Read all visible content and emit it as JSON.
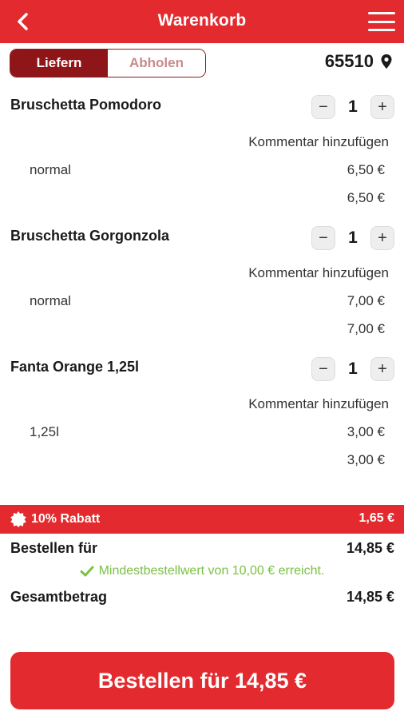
{
  "header": {
    "title": "Warenkorb",
    "accent": "#e32b2f",
    "back_icon": "chevron-left-icon",
    "menu_icon": "hamburger-menu-icon"
  },
  "delivery_toggle": {
    "options": [
      "Liefern",
      "Abholen"
    ],
    "selected": "Liefern"
  },
  "postcode": {
    "value": "65510",
    "icon": "location-pin-icon"
  },
  "items": [
    {
      "name": "Bruschetta Pomodoro",
      "quantity": "1",
      "comment_label": "Kommentar hinzufügen",
      "variant": "normal",
      "variant_price": "6,50 €",
      "total": "6,50 €"
    },
    {
      "name": "Bruschetta Gorgonzola",
      "quantity": "1",
      "comment_label": "Kommentar hinzufügen",
      "variant": "normal",
      "variant_price": "7,00 €",
      "total": "7,00 €"
    },
    {
      "name": "Fanta Orange 1,25l",
      "quantity": "1",
      "comment_label": "Kommentar hinzufügen",
      "variant": "1,25l",
      "variant_price": "3,00 €",
      "total": "3,00 €"
    }
  ],
  "stepper": {
    "minus": "−",
    "plus": "+"
  },
  "discount": {
    "label": "10% Rabatt",
    "amount": "1,65 €",
    "icon": "badge-icon"
  },
  "summary": {
    "order_for_label": "Bestellen für",
    "order_for_value": "14,85 €",
    "minimum_text": "Mindestbestellwert von 10,00 € erreicht.",
    "minimum_color": "#7bc142",
    "total_label": "Gesamtbetrag",
    "total_value": "14,85 €"
  },
  "order_button": {
    "label": "Bestellen für 14,85 €"
  }
}
